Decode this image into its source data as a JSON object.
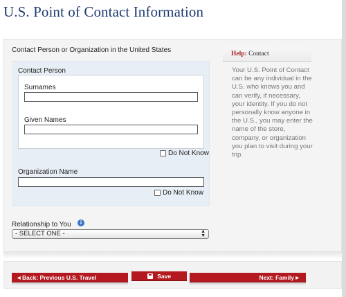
{
  "page": {
    "title": "U.S. Point of Contact Information"
  },
  "form": {
    "section_label": "Contact Person or Organization in the United States",
    "contact_person_label": "Contact Person",
    "surnames_label": "Surnames",
    "surnames_value": "",
    "given_names_label": "Given Names",
    "given_names_value": "",
    "do_not_know_label": "Do Not Know",
    "organization_label": "Organization Name",
    "organization_value": "",
    "org_do_not_know_label": "Do Not Know",
    "relationship_label": "Relationship to You",
    "relationship_selected": "- SELECT ONE -",
    "info_glyph": "i"
  },
  "help": {
    "prefix": "Help:",
    "title": "Contact",
    "text": "Your U.S. Point of Contact can be any individual in the U.S. who knows you and can verify, if necessary, your identity. If you do not personally know anyone in the U.S., you may enter the name of the store, company, or organization you plan to visit during your trip."
  },
  "nav": {
    "back_label": "Back: Previous U.S. Travel",
    "save_label": "Save",
    "next_label": "Next: Family"
  },
  "icons": {
    "back_arrow": "◀",
    "next_arrow": "▶",
    "save_icon": "disk-icon",
    "select_arrows": "▲▼"
  },
  "colors": {
    "title": "#1f3a6e",
    "button": "#b3191f",
    "help_accent": "#a52020",
    "info_icon": "#3a72c4"
  }
}
